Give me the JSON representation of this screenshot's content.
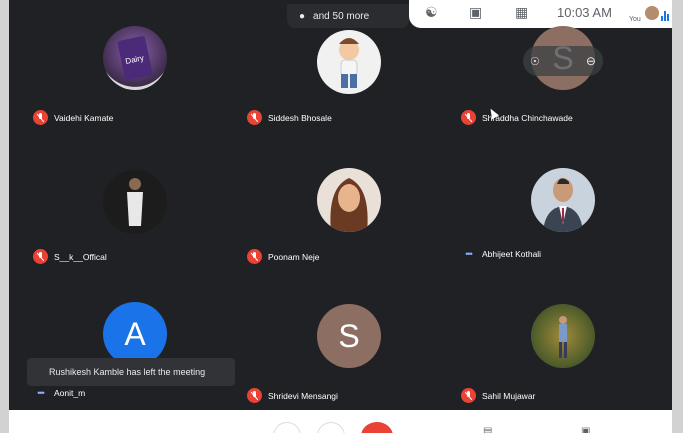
{
  "topbar": {
    "participants_more": "and 50 more",
    "time": "10:03 AM",
    "you_label": "You"
  },
  "participants": [
    {
      "name": "Vaidehi Kamate",
      "muted": true,
      "avatar_type": "photo",
      "color": "#6b4e8a"
    },
    {
      "name": "Siddesh Bhosale",
      "muted": true,
      "avatar_type": "photo",
      "color": "#dcdcdc"
    },
    {
      "name": "Shraddha Chinchawade",
      "muted": true,
      "avatar_type": "letter",
      "letter": "S",
      "color": "#8d6e63"
    },
    {
      "name": "S__k__Offical",
      "muted": true,
      "avatar_type": "photo",
      "color": "#333333"
    },
    {
      "name": "Poonam Neje",
      "muted": true,
      "avatar_type": "photo",
      "color": "#b07a55"
    },
    {
      "name": "Abhijeet Kothali",
      "muted": false,
      "avatar_type": "photo",
      "color": "#9aa6b2"
    },
    {
      "name": "Aonit_m",
      "muted": false,
      "avatar_type": "letter",
      "letter": "A",
      "color": "#1a73e8"
    },
    {
      "name": "Shridevi Mensangi",
      "muted": true,
      "avatar_type": "letter",
      "letter": "S",
      "color": "#8d6e63"
    },
    {
      "name": "Sahil Mujawar",
      "muted": true,
      "avatar_type": "photo",
      "color": "#8a7a3a"
    }
  ],
  "toast": {
    "message": "Rushikesh Kamble has left the meeting"
  },
  "icons": {
    "mic_off": "mic-off-icon",
    "pin": "pin-icon",
    "remove": "remove-icon"
  },
  "colors": {
    "background": "#202124",
    "mute_red": "#ea4335",
    "accent_blue": "#1a73e8"
  }
}
